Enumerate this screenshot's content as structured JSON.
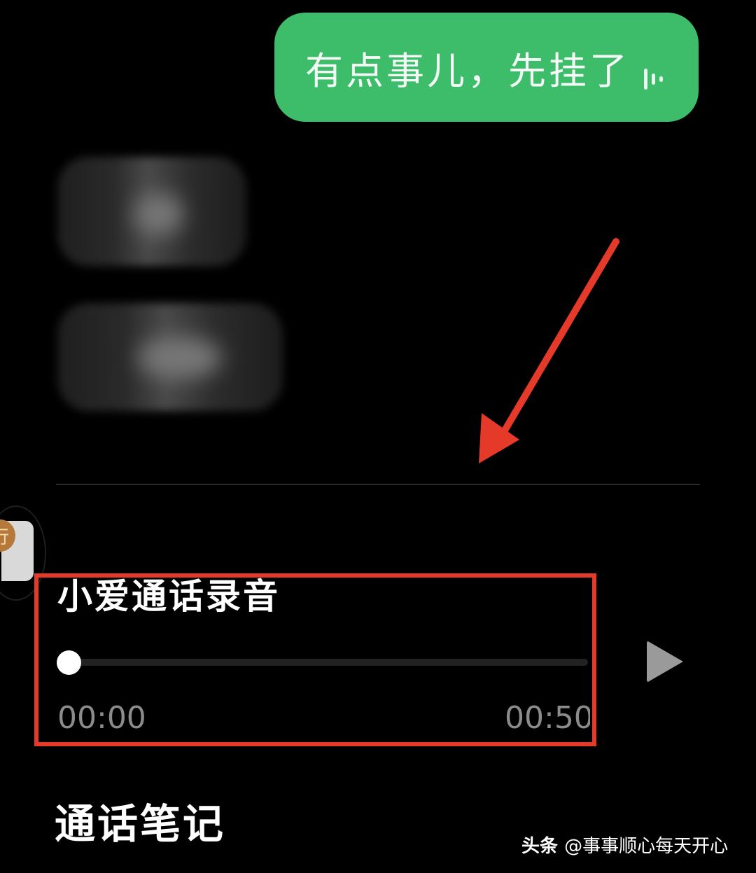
{
  "chat": {
    "outgoing_message": "有点事儿，先挂了",
    "outgoing_voice_icon": "voice-wave-icon"
  },
  "recording": {
    "title": "小爱通话录音",
    "current_time": "00:00",
    "total_time": "00:50",
    "progress": 0,
    "play_icon": "play-icon"
  },
  "notes": {
    "title": "通话笔记"
  },
  "side_button": {
    "glyph": "行"
  },
  "watermark": {
    "brand": "头条",
    "handle": "@事事顺心每天开心"
  },
  "colors": {
    "background": "#000000",
    "outgoing_bubble": "#3dbd6a",
    "annotation_red": "#e53a2a",
    "progress_knob": "#ffffff",
    "time_text": "#8b8b8b"
  }
}
